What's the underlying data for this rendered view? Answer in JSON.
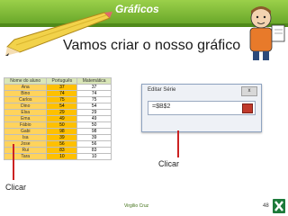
{
  "header": {
    "title": "Gráficos"
  },
  "main": {
    "subtitle": "Vamos criar o nosso gráfico"
  },
  "table": {
    "headers": [
      "Nome do aluno",
      "Português",
      "Matemática"
    ],
    "rows": [
      {
        "name": "Ana",
        "pt": "37",
        "mat": "37"
      },
      {
        "name": "Bino",
        "pt": "74",
        "mat": "74"
      },
      {
        "name": "Carlos",
        "pt": "75",
        "mat": "75"
      },
      {
        "name": "Dino",
        "pt": "54",
        "mat": "54"
      },
      {
        "name": "Elsa",
        "pt": "29",
        "mat": "29"
      },
      {
        "name": "Ema",
        "pt": "49",
        "mat": "49"
      },
      {
        "name": "Fábio",
        "pt": "50",
        "mat": "50"
      },
      {
        "name": "Gabi",
        "pt": "98",
        "mat": "98"
      },
      {
        "name": "Isa",
        "pt": "39",
        "mat": "39"
      },
      {
        "name": "Jose",
        "pt": "56",
        "mat": "56"
      },
      {
        "name": "Rui",
        "pt": "83",
        "mat": "83"
      },
      {
        "name": "Tara",
        "pt": "10",
        "mat": "10"
      }
    ]
  },
  "dialog": {
    "title": "Editar Série",
    "close_label": "x",
    "input_value": "=$B$2"
  },
  "labels": {
    "left_click": "Clicar",
    "right_click": "Clicar"
  },
  "footer": {
    "author": "Virgílio Cruz",
    "page": "48"
  }
}
